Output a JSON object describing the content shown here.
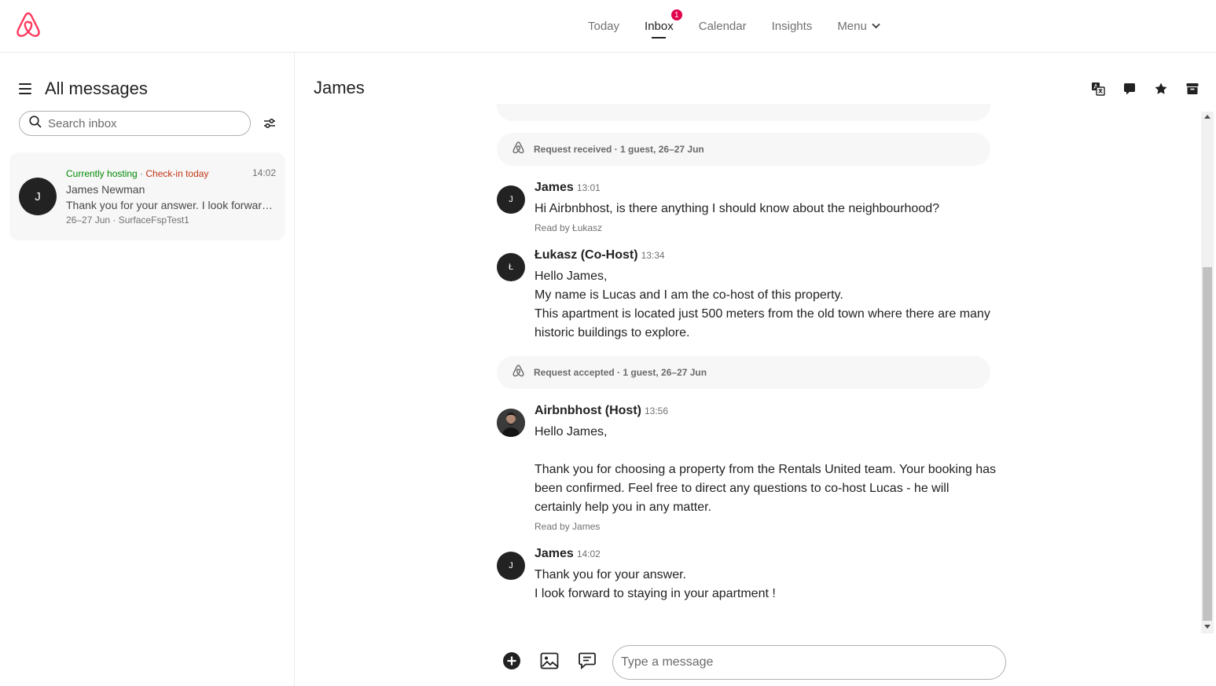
{
  "colors": {
    "brand": "#FF385C",
    "badge": "#E0004D",
    "hosting_green": "#008A05",
    "checkin_red": "#C13515"
  },
  "nav": {
    "today": "Today",
    "inbox": "Inbox",
    "inbox_badge": "1",
    "calendar": "Calendar",
    "insights": "Insights",
    "menu": "Menu"
  },
  "sidebar": {
    "title": "All messages",
    "search_placeholder": "Search inbox",
    "thread": {
      "avatar_initial": "J",
      "status_hosting": "Currently hosting",
      "status_sep": " · ",
      "status_checkin": "Check-in today",
      "time": "14:02",
      "name": "James Newman",
      "preview": "Thank you for your answer. I look forward to staying in your apartment !",
      "meta": "26–27 Jun · SurfaceFspTest1"
    }
  },
  "conversation": {
    "title": "James",
    "events": {
      "received": "Request received · 1 guest, 26–27 Jun",
      "accepted": "Request accepted · 1 guest, 26–27 Jun"
    },
    "messages": [
      {
        "initial": "J",
        "name": "James",
        "time": "13:01",
        "lines": [
          "Hi Airbnbhost, is there anything I should know about the neighbourhood?"
        ],
        "read": "Read by Łukasz"
      },
      {
        "initial": "Ł",
        "name": "Łukasz (Co-Host)",
        "time": "13:34",
        "lines": [
          "Hello James,",
          "My name is Lucas and I am the co-host of this property.",
          "This apartment is located just 500 meters from the old town where there are many historic buildings to explore."
        ]
      },
      {
        "initial": "",
        "name": "Airbnbhost (Host)",
        "time": "13:56",
        "lines": [
          "Hello James,",
          "",
          "Thank you for choosing a property from the Rentals United team. Your booking has been confirmed. Feel free to direct any questions to co-host Lucas - he will certainly help you in any matter."
        ],
        "read": "Read by James"
      },
      {
        "initial": "J",
        "name": "James",
        "time": "14:02",
        "lines": [
          "Thank you for your answer.",
          "I look forward to staying in your apartment !"
        ]
      }
    ]
  },
  "composer": {
    "placeholder": "Type a message"
  },
  "icons": {
    "logo": "airbnb-logo",
    "menu": "hamburger-icon",
    "search": "search-icon",
    "filter": "filter-icon",
    "translate": "translate-icon",
    "details": "chat-bubble-icon",
    "star": "star-icon",
    "archive": "archive-icon",
    "add": "plus-circle-icon",
    "image": "image-icon",
    "quick_reply": "quick-reply-icon",
    "system_event": "airbnb-logo-small-icon"
  }
}
